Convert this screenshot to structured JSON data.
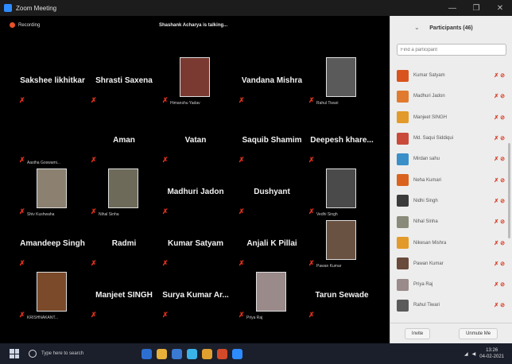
{
  "window": {
    "title": "Zoom Meeting"
  },
  "meeting": {
    "recording_label": "Recording",
    "active_speaker": "Shashank Acharya is talking...",
    "tiles": [
      {
        "name": "Sakshee likhitkar"
      },
      {
        "name": "Shrasti Saxena"
      },
      {
        "name": "",
        "label": "Himanshu Yadav",
        "photo": "#7a3a32"
      },
      {
        "name": "Vandana Mishra"
      },
      {
        "name": "",
        "label": "Rahul Tiwari",
        "photo": "#5a5a5a"
      },
      {
        "name": "",
        "label": "Aastha Goswami..."
      },
      {
        "name": "Aman"
      },
      {
        "name": "Vatan"
      },
      {
        "name": "Saquib Shamim"
      },
      {
        "name": "Deepesh khare..."
      },
      {
        "name": "",
        "label": "Shiv Kushwaha",
        "photo": "#8c8070"
      },
      {
        "name": "",
        "label": "Nihal Sinha",
        "photo": "#6d6a5a"
      },
      {
        "name": "Madhuri Jadon"
      },
      {
        "name": "Dushyant"
      },
      {
        "name": "",
        "label": "Vedhi Singh",
        "photo": "#4a4a4a"
      },
      {
        "name": "Amandeep Singh"
      },
      {
        "name": "Radmi"
      },
      {
        "name": "Kumar Satyam"
      },
      {
        "name": "Anjali K Pillai"
      },
      {
        "name": "",
        "label": "Pawan Kumar",
        "photo": "#6a5242"
      },
      {
        "name": "",
        "label": "KRISHNAKANT...",
        "photo": "#7a4a2a"
      },
      {
        "name": "Manjeet SINGH"
      },
      {
        "name": "Surya Kumar Ar..."
      },
      {
        "name": "",
        "label": "Priya Raj",
        "photo": "#9a8a8a"
      },
      {
        "name": "Tarun Sewade"
      }
    ]
  },
  "participants": {
    "title": "Participants (46)",
    "search_placeholder": "Find a participant",
    "items": [
      {
        "name": "Kumar Satyam",
        "color": "#d9531e"
      },
      {
        "name": "Madhuri Jadon",
        "color": "#e07a2e"
      },
      {
        "name": "Manjeet SINGH",
        "color": "#e39a2a"
      },
      {
        "name": "Md. Saqui Siddiqui",
        "color": "#c94a3a"
      },
      {
        "name": "Mirdan sahu",
        "color": "#3a8fc9"
      },
      {
        "name": "Neha Kumari",
        "color": "#d9631e"
      },
      {
        "name": "Nidhi Singh",
        "color": "#3b3b3b"
      },
      {
        "name": "Nihal Sinha",
        "color": "#8a8a7a"
      },
      {
        "name": "Nikesan Mishra",
        "color": "#e39a2a"
      },
      {
        "name": "Pawan Kumar",
        "color": "#6a4a3a"
      },
      {
        "name": "Priya Raj",
        "color": "#9a8a8a"
      },
      {
        "name": "Rahul Tiwari",
        "color": "#5a5a5a"
      }
    ],
    "invite_label": "Invite",
    "unmute_label": "Unmute Me"
  },
  "taskbar": {
    "search_placeholder": "Type here to search",
    "time": "13:26",
    "date": "04-02-2021"
  }
}
